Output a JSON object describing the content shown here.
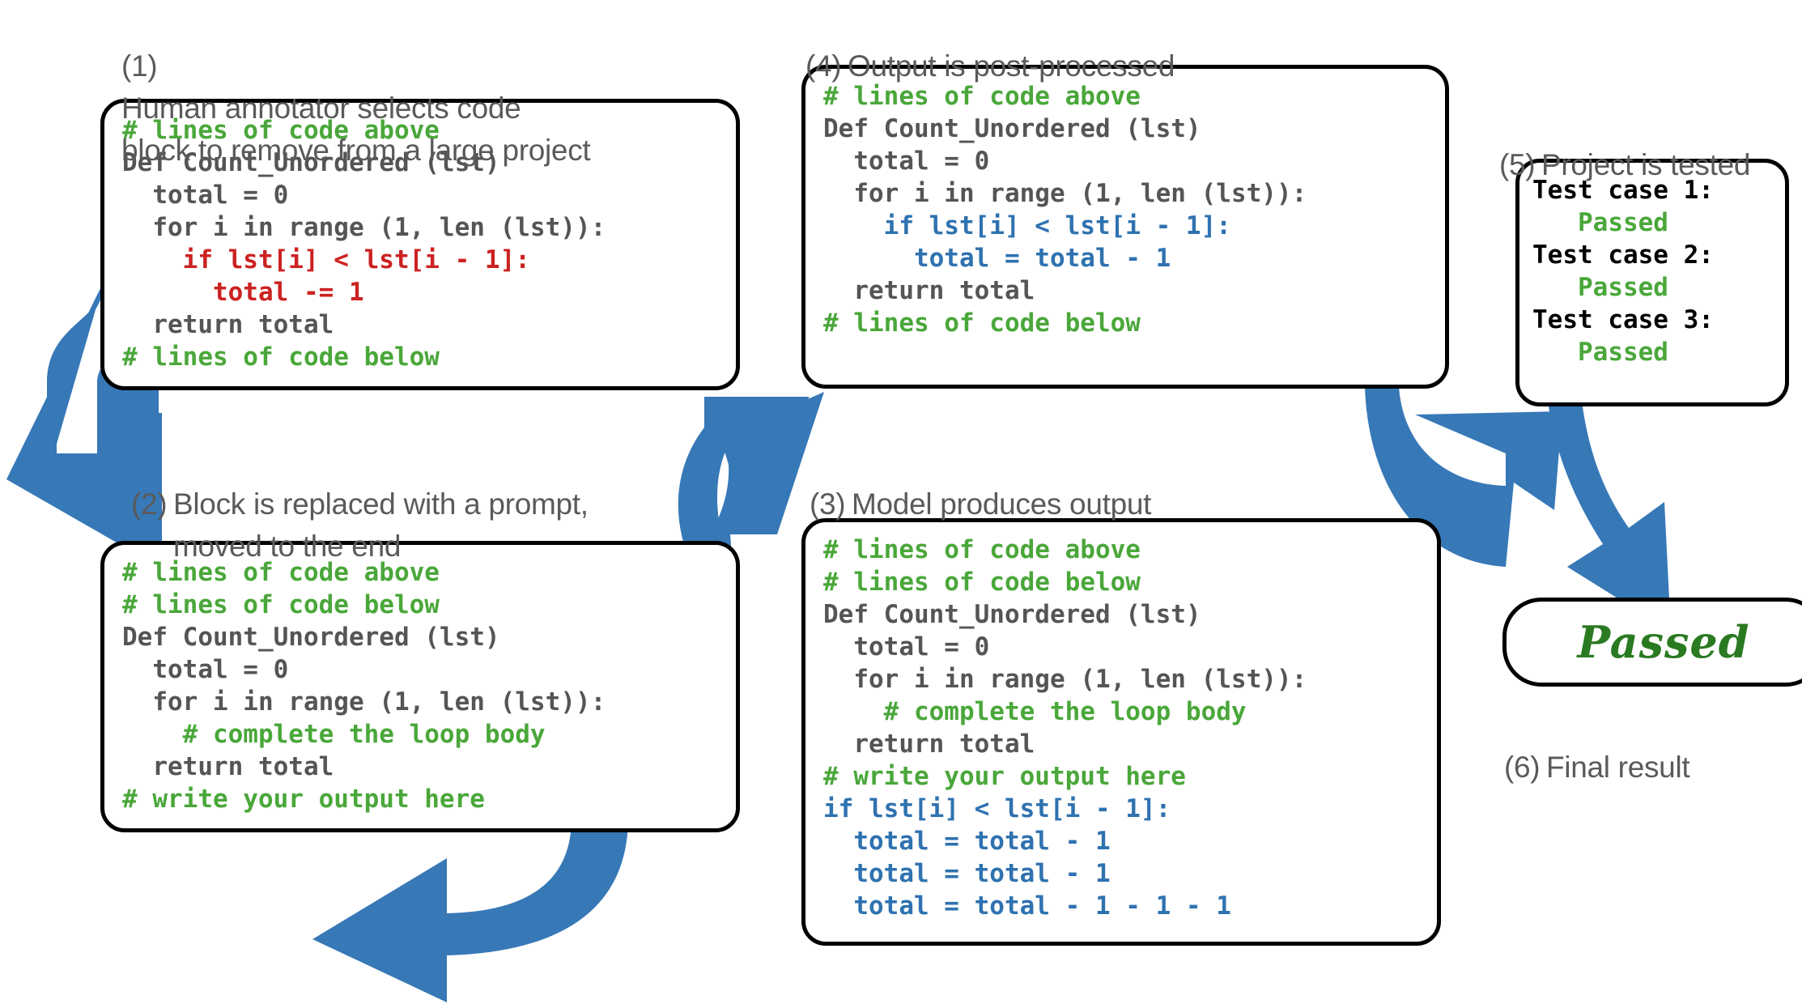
{
  "colors": {
    "arrow_blue": "#3778B7",
    "code_gray": "#555555",
    "code_green": "#4aa73a",
    "code_red": "#cc2222",
    "code_blue": "#2f72b0",
    "caption_gray": "#5a5a5a",
    "pass_green": "#2a7a22",
    "box_border": "#000000"
  },
  "steps": {
    "s1": {
      "num": "(1)",
      "text": "Human annotator selects code\nblock to remove from a large project"
    },
    "s2": {
      "num": "(2)",
      "text": "Block is replaced with a prompt,\nmoved to the end"
    },
    "s3": {
      "num": "(3)",
      "text": "Model produces output"
    },
    "s4": {
      "num": "(4)",
      "text": "Output is post-processed"
    },
    "s5": {
      "num": "(5)",
      "text": "Project is tested"
    },
    "s6": {
      "num": "(6)",
      "text": "Final result"
    }
  },
  "box1": {
    "lines": [
      {
        "t": "# lines of code above",
        "c": "green"
      },
      {
        "t": "Def Count_Unordered (lst)",
        "c": "gray"
      },
      {
        "t": "  total = 0",
        "c": "gray"
      },
      {
        "t": "  for i in range (1, len (lst)):",
        "c": "gray"
      },
      {
        "t": "    if lst[i] < lst[i - 1]:",
        "c": "red"
      },
      {
        "t": "      total -= 1",
        "c": "red"
      },
      {
        "t": "  return total",
        "c": "gray"
      },
      {
        "t": "# lines of code below",
        "c": "green"
      }
    ]
  },
  "box2": {
    "lines": [
      {
        "t": "# lines of code above",
        "c": "green"
      },
      {
        "t": "# lines of code below",
        "c": "green"
      },
      {
        "t": "Def Count_Unordered (lst)",
        "c": "gray"
      },
      {
        "t": "  total = 0",
        "c": "gray"
      },
      {
        "t": "  for i in range (1, len (lst)):",
        "c": "gray"
      },
      {
        "t": "    # complete the loop body",
        "c": "green"
      },
      {
        "t": "  return total",
        "c": "gray"
      },
      {
        "t": "# write your output here",
        "c": "green"
      }
    ]
  },
  "box3": {
    "lines": [
      {
        "t": "# lines of code above",
        "c": "green"
      },
      {
        "t": "# lines of code below",
        "c": "green"
      },
      {
        "t": "Def Count_Unordered (lst)",
        "c": "gray"
      },
      {
        "t": "  total = 0",
        "c": "gray"
      },
      {
        "t": "  for i in range (1, len (lst)):",
        "c": "gray"
      },
      {
        "t": "    # complete the loop body",
        "c": "green"
      },
      {
        "t": "  return total",
        "c": "gray"
      },
      {
        "t": "# write your output here",
        "c": "green"
      },
      {
        "t": "if lst[i] < lst[i - 1]:",
        "c": "blue"
      },
      {
        "t": "  total = total - 1",
        "c": "blue"
      },
      {
        "t": "  total = total - 1",
        "c": "blue"
      },
      {
        "t": "  total = total - 1 - 1 - 1",
        "c": "blue"
      }
    ]
  },
  "box4": {
    "lines": [
      {
        "t": "# lines of code above",
        "c": "green"
      },
      {
        "t": "Def Count_Unordered (lst)",
        "c": "gray"
      },
      {
        "t": "  total = 0",
        "c": "gray"
      },
      {
        "t": "  for i in range (1, len (lst)):",
        "c": "gray"
      },
      {
        "t": "    if lst[i] < lst[i - 1]:",
        "c": "blue"
      },
      {
        "t": "      total = total - 1",
        "c": "blue"
      },
      {
        "t": "  return total",
        "c": "gray"
      },
      {
        "t": "# lines of code below",
        "c": "green"
      }
    ]
  },
  "box5": {
    "lines": [
      {
        "t": "Test case 1:",
        "c": "black"
      },
      {
        "t": "   Passed",
        "c": "green"
      },
      {
        "t": "Test case 2:",
        "c": "black"
      },
      {
        "t": "   Passed",
        "c": "green"
      },
      {
        "t": "Test case 3:",
        "c": "black"
      },
      {
        "t": "   Passed",
        "c": "green"
      }
    ]
  },
  "final_result": {
    "label": "Passed"
  }
}
